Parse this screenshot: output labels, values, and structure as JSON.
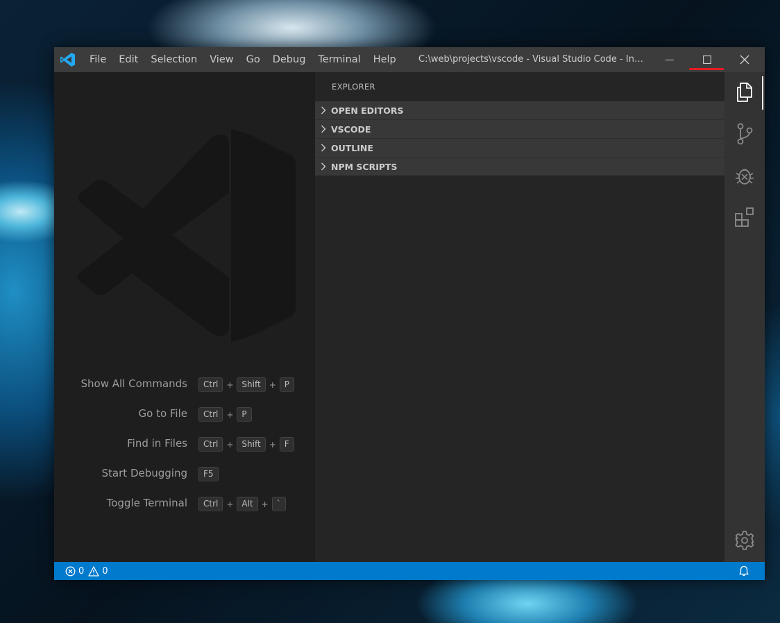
{
  "titlebar": {
    "menu": [
      "File",
      "Edit",
      "Selection",
      "View",
      "Go",
      "Debug",
      "Terminal",
      "Help"
    ],
    "title": "C:\\web\\projects\\vscode - Visual Studio Code - Insi..."
  },
  "editor": {
    "shortcuts": [
      {
        "label": "Show All Commands",
        "keys": [
          "Ctrl",
          "Shift",
          "P"
        ]
      },
      {
        "label": "Go to File",
        "keys": [
          "Ctrl",
          "P"
        ]
      },
      {
        "label": "Find in Files",
        "keys": [
          "Ctrl",
          "Shift",
          "F"
        ]
      },
      {
        "label": "Start Debugging",
        "keys": [
          "F5"
        ]
      },
      {
        "label": "Toggle Terminal",
        "keys": [
          "Ctrl",
          "Alt",
          "`"
        ]
      }
    ]
  },
  "sidebar": {
    "title": "EXPLORER",
    "sections": [
      "OPEN EDITORS",
      "VSCODE",
      "OUTLINE",
      "NPM SCRIPTS"
    ]
  },
  "statusbar": {
    "errors": "0",
    "warnings": "0"
  },
  "colors": {
    "statusbar": "#007acc",
    "titlebar": "#3c3c3c",
    "sidebar": "#252526",
    "activitybar": "#333333",
    "editor": "#1e1e1e",
    "logo": "#23a9f2",
    "maximize_highlight": "#e51b24"
  },
  "icons": {
    "activitybar": [
      "explorer-icon",
      "source-control-icon",
      "debug-icon",
      "extensions-icon",
      "settings-gear-icon"
    ]
  }
}
